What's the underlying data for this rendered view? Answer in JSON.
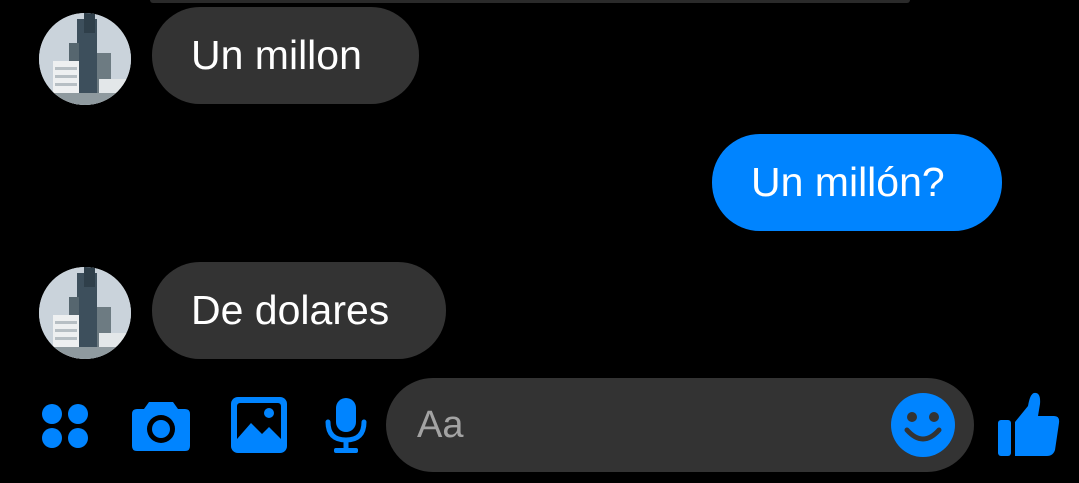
{
  "conversation": {
    "messages": [
      {
        "direction": "incoming",
        "text": "Un millon",
        "avatar": "building-photo"
      },
      {
        "direction": "outgoing",
        "text": "Un millón?"
      },
      {
        "direction": "incoming",
        "text": "De dolares",
        "avatar": "building-photo"
      }
    ]
  },
  "composer": {
    "placeholder": "Aa",
    "icons": [
      "apps-icon",
      "camera-icon",
      "gallery-icon",
      "microphone-icon",
      "emoji-icon",
      "thumbs-up-icon"
    ]
  },
  "colors": {
    "background": "#000000",
    "incoming_bubble": "#333333",
    "outgoing_bubble": "#0084ff",
    "accent": "#0084ff",
    "input_background": "#333333",
    "placeholder_text": "#a3a3a3",
    "message_text": "#ffffff"
  }
}
